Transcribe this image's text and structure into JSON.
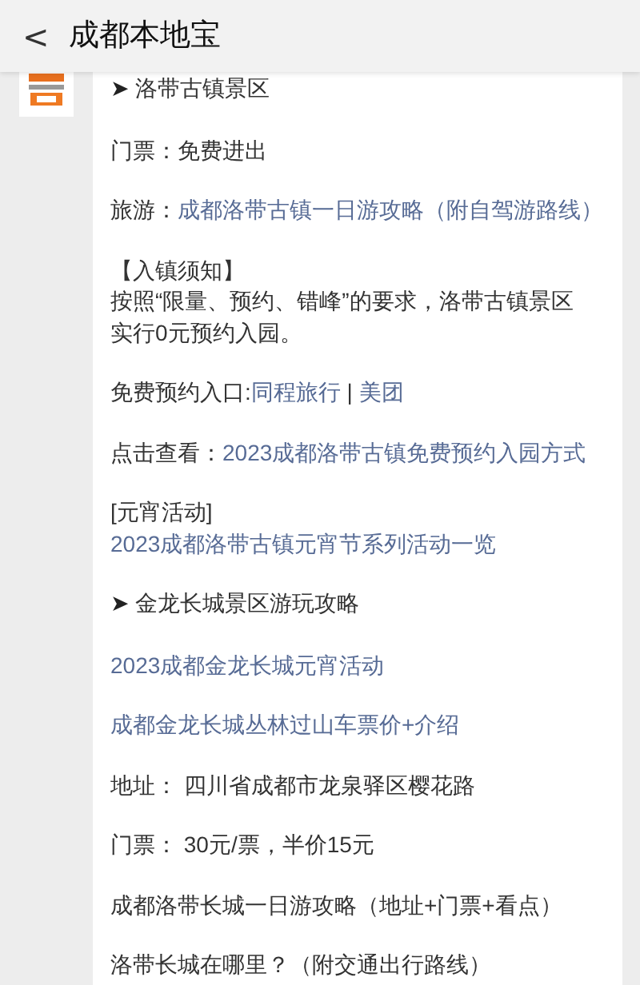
{
  "header": {
    "back": "<",
    "title": "成都本地宝"
  },
  "paragraphs": [
    {
      "lines": [
        [
          {
            "kind": "bullet",
            "text": "➤"
          },
          {
            "kind": "plain",
            "text": " 洛带古镇景区"
          }
        ]
      ]
    },
    {
      "lines": [
        [
          {
            "kind": "plain",
            "text": "门票：免费进出"
          }
        ]
      ]
    },
    {
      "lines": [
        [
          {
            "kind": "plain",
            "text": "旅游："
          },
          {
            "kind": "link",
            "text": "成都洛带古镇一日游攻略（附自驾游路线）"
          }
        ]
      ]
    },
    {
      "lines": [
        [
          {
            "kind": "plain",
            "text": "【入镇须知】"
          }
        ],
        [
          {
            "kind": "plain",
            "text": "按照“限量、预约、错峰”的要求，洛带古镇景区实行0元预约入园。"
          }
        ]
      ]
    },
    {
      "lines": [
        [
          {
            "kind": "plain",
            "text": "免费预约入口:"
          },
          {
            "kind": "link",
            "text": "同程旅行"
          },
          {
            "kind": "plain",
            "text": " | "
          },
          {
            "kind": "link",
            "text": "美团"
          }
        ]
      ]
    },
    {
      "lines": [
        [
          {
            "kind": "plain",
            "text": "点击查看："
          },
          {
            "kind": "link",
            "text": "2023成都洛带古镇免费预约入园方式"
          }
        ]
      ]
    },
    {
      "lines": [
        [
          {
            "kind": "plain",
            "text": "[元宵活动]"
          }
        ],
        [
          {
            "kind": "link",
            "text": "2023成都洛带古镇元宵节系列活动一览"
          }
        ]
      ]
    },
    {
      "lines": [
        [
          {
            "kind": "bullet",
            "text": "➤"
          },
          {
            "kind": "plain",
            "text": " 金龙长城景区游玩攻略"
          }
        ]
      ]
    },
    {
      "lines": [
        [
          {
            "kind": "link",
            "text": "2023成都金龙长城元宵活动"
          }
        ]
      ]
    },
    {
      "lines": [
        [
          {
            "kind": "link",
            "text": "成都金龙长城丛林过山车票价+介绍"
          }
        ]
      ]
    },
    {
      "lines": [
        [
          {
            "kind": "plain",
            "text": "地址： 四川省成都市龙泉驿区樱花路"
          }
        ]
      ]
    },
    {
      "lines": [
        [
          {
            "kind": "plain",
            "text": "门票： 30元/票，半价15元"
          }
        ]
      ]
    },
    {
      "lines": [
        [
          {
            "kind": "plain",
            "text": "成都洛带长城一日游攻略（地址+门票+看点）"
          }
        ]
      ]
    },
    {
      "lines": [
        [
          {
            "kind": "plain",
            "text": "洛带长城在哪里？（附交通出行路线）"
          }
        ]
      ]
    }
  ]
}
